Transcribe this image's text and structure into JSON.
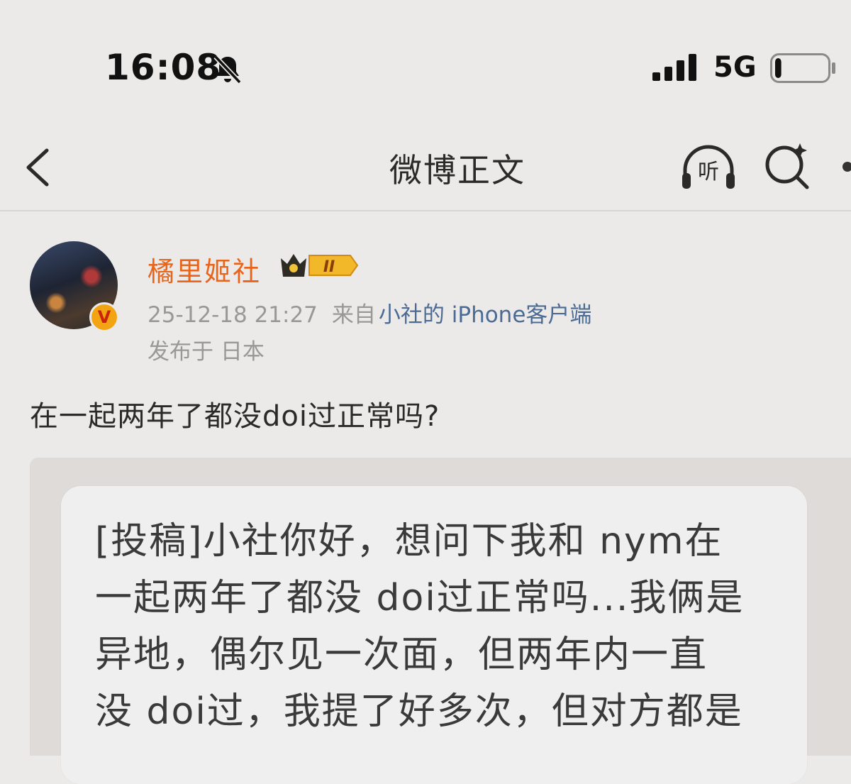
{
  "status_bar": {
    "time": "16:08",
    "network": "5G",
    "signal_bars": 4,
    "battery_level_fraction": 0.12
  },
  "nav": {
    "title": "微博正文",
    "listen_label": "听"
  },
  "post": {
    "username": "橘里姬社",
    "member_level": "II",
    "verified_badge": "V",
    "timestamp": "25-12-18 21:27",
    "from_prefix": "来自",
    "source": "小社的 iPhone客户端",
    "location": "发布于 日本",
    "text": "在一起两年了都没doi过正常吗?"
  },
  "embedded_image": {
    "lines": [
      "[投稿]小社你好，想问下我和 nym在",
      "一起两年了都没 doi过正常吗...我俩是",
      "异地，偶尔见一次面，但两年内一直",
      "没 doi过，我提了好多次，但对方都是"
    ]
  },
  "colors": {
    "username": "#e8641b",
    "source_link": "#4b6b94",
    "background": "#eceae8"
  }
}
